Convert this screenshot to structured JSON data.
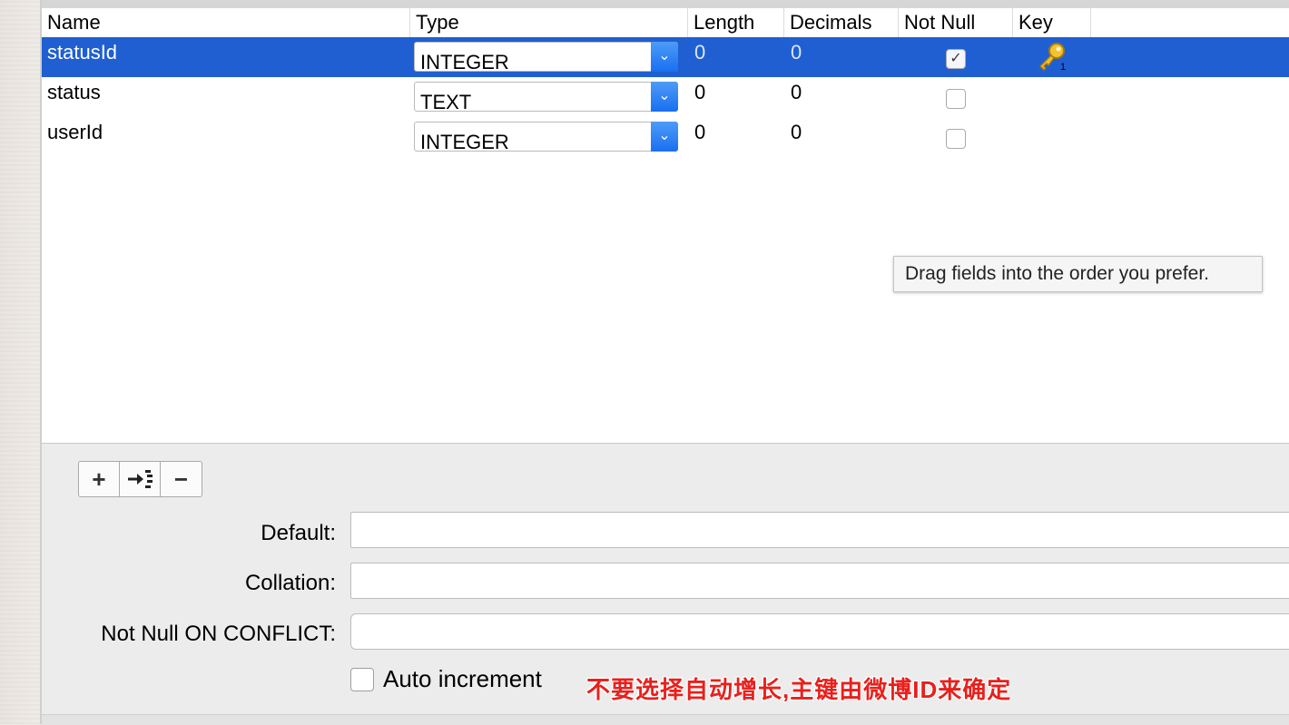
{
  "table": {
    "columns": [
      "Name",
      "Type",
      "Length",
      "Decimals",
      "Not Null",
      "Key"
    ],
    "rows": [
      {
        "name": "statusId",
        "type": "INTEGER",
        "length": "0",
        "decimals": "0",
        "not_null": true,
        "key": "primary-key-icon",
        "selected": true
      },
      {
        "name": "status",
        "type": "TEXT",
        "length": "0",
        "decimals": "0",
        "not_null": false,
        "key": "",
        "selected": false
      },
      {
        "name": "userId",
        "type": "INTEGER",
        "length": "0",
        "decimals": "0",
        "not_null": false,
        "key": "",
        "selected": false
      }
    ]
  },
  "tooltip": "Drag fields into the order you prefer.",
  "toolbar": {
    "add_label": "+",
    "insert_icon": "insert-field-icon",
    "remove_label": "−"
  },
  "form": {
    "default_label": "Default:",
    "default_value": "",
    "collation_label": "Collation:",
    "collation_value": "",
    "conflict_label": "Not Null ON CONFLICT:",
    "conflict_value": "",
    "auto_increment_label": "Auto increment",
    "auto_increment": false
  },
  "annotation": "不要选择自动增长,主键由微博ID来确定",
  "colors": {
    "selection": "#1f5fd1",
    "select_arrow": "#1a6ff0",
    "annotation": "#e8201c"
  }
}
